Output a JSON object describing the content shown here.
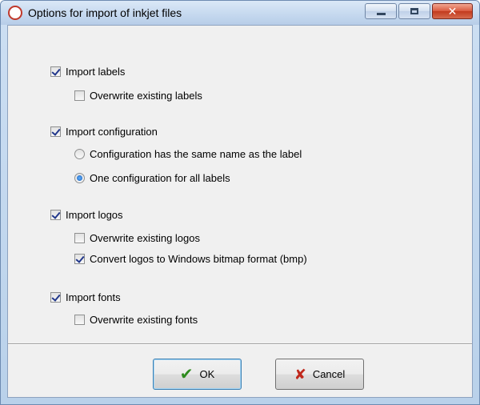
{
  "window": {
    "title": "Options for import of inkjet files",
    "app_icon": "app-logo-icon",
    "controls": {
      "minimize": "minimize-icon",
      "maximize": "maximize-icon",
      "close": "close-icon",
      "close_glyph": "✕"
    }
  },
  "options": {
    "import_labels": {
      "label": "Import labels",
      "checked": true
    },
    "overwrite_labels": {
      "label": "Overwrite existing labels",
      "checked": false
    },
    "import_configuration": {
      "label": "Import configuration",
      "checked": true
    },
    "config_same_name": {
      "label": "Configuration has the same name as the label",
      "selected": false
    },
    "config_one_for_all": {
      "label": "One configuration for all labels",
      "selected": true
    },
    "import_logos": {
      "label": "Import logos",
      "checked": true
    },
    "overwrite_logos": {
      "label": "Overwrite existing logos",
      "checked": false
    },
    "convert_logos_bmp": {
      "label": "Convert logos to Windows bitmap format (bmp)",
      "checked": true
    },
    "import_fonts": {
      "label": "Import fonts",
      "checked": true
    },
    "overwrite_fonts": {
      "label": "Overwrite existing fonts",
      "checked": false
    }
  },
  "buttons": {
    "ok": {
      "label": "OK",
      "icon": "checkmark-icon",
      "glyph": "✔",
      "color": "#2e8b1e"
    },
    "cancel": {
      "label": "Cancel",
      "icon": "cross-icon",
      "glyph": "✘",
      "color": "#c0281c"
    }
  }
}
